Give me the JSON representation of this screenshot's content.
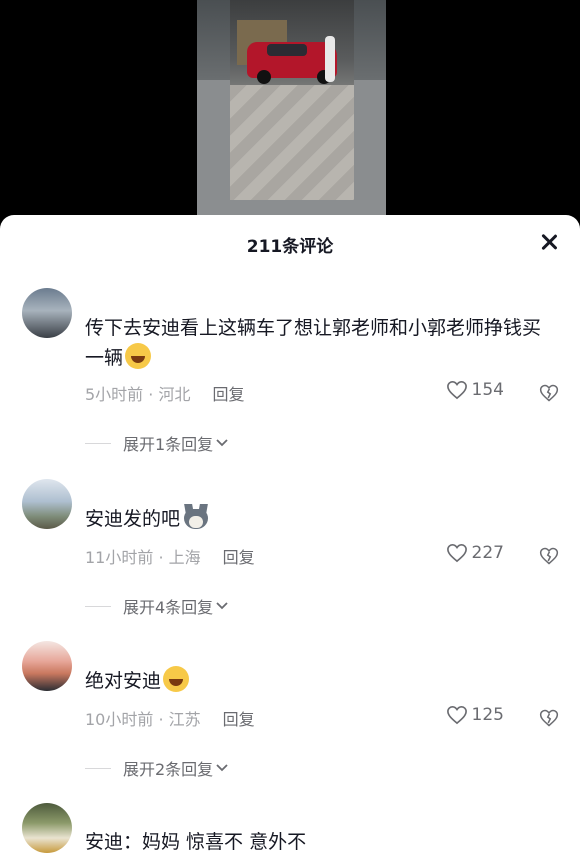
{
  "sheet": {
    "title": "211条评论"
  },
  "comments": [
    {
      "text": "传下去安迪看上这辆车了想让郭老师和小郭老师挣钱买一辆",
      "emoji": "laughing-emoji",
      "time": "5小时前 · 河北",
      "reply": "回复",
      "likes": "154",
      "expand": "展开1条回复"
    },
    {
      "text": "安迪发的吧",
      "emoji": "dog-emoji",
      "time": "11小时前 · 上海",
      "reply": "回复",
      "likes": "227",
      "expand": "展开4条回复"
    },
    {
      "text": "绝对安迪",
      "emoji": "laughing-emoji",
      "time": "10小时前 · 江苏",
      "reply": "回复",
      "likes": "125",
      "expand": "展开2条回复"
    },
    {
      "text": "安迪：妈妈 惊喜不 意外不"
    }
  ]
}
